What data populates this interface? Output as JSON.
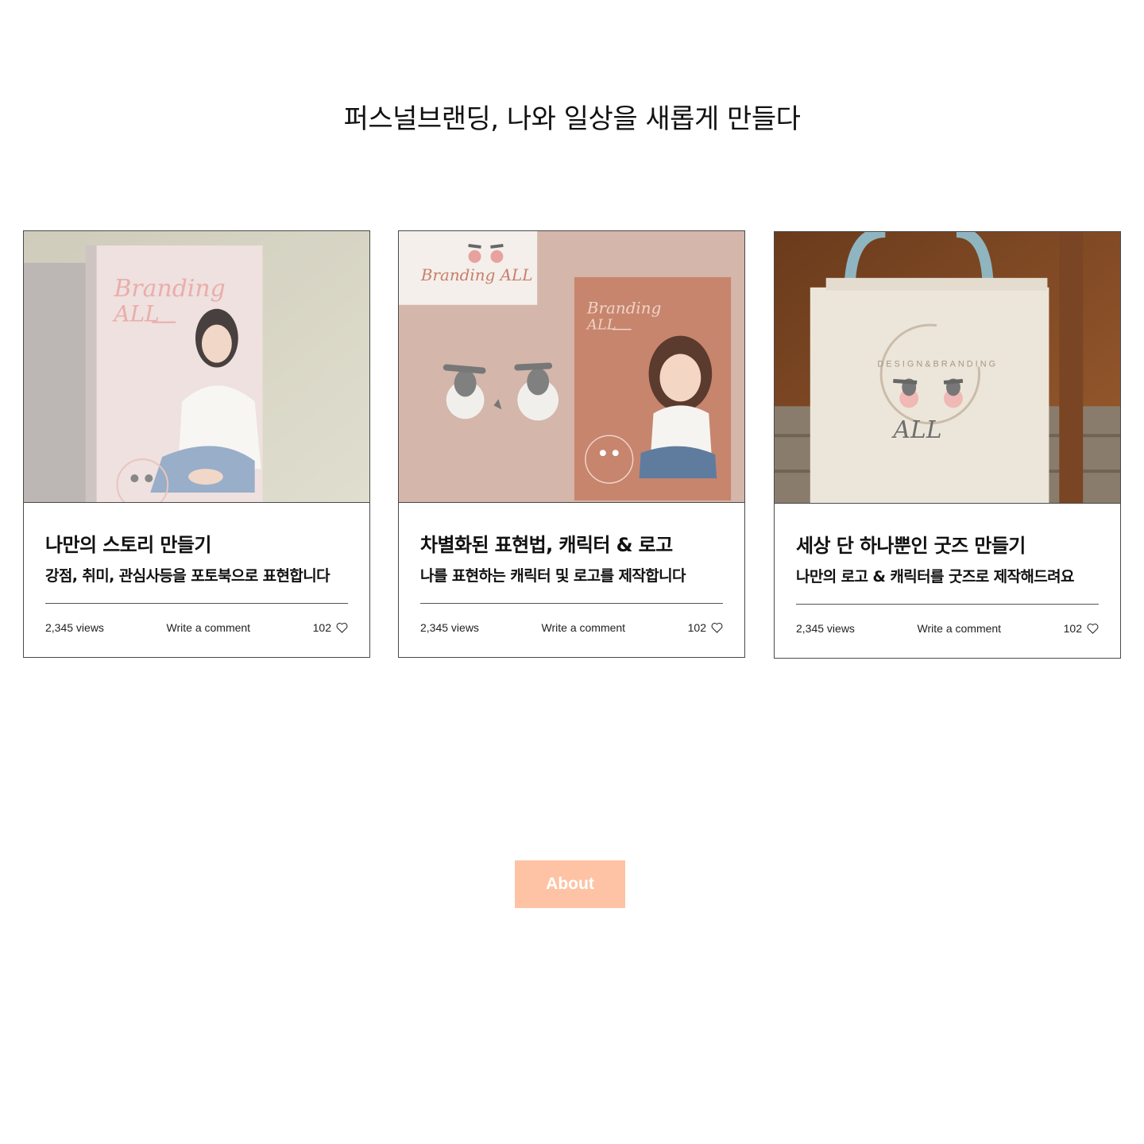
{
  "page": {
    "title": "퍼스널브랜딩, 나와 일상을 새롭게 만들다"
  },
  "cards": [
    {
      "title": "나만의 스토리 만들기",
      "subtitle": "강점, 취미, 관심사등을 포토북으로 표현합니다",
      "views": "2,345 views",
      "comment_label": "Write a comment",
      "likes": "102",
      "image": {
        "description_icon": "photobook-image",
        "cover_text": "Branding ALL___"
      }
    },
    {
      "title": "차별화된 표현법, 캐릭터 & 로고",
      "subtitle": "나를 표현하는 캐릭터 및 로고를 제작합니다",
      "views": "2,345 views",
      "comment_label": "Write a comment",
      "likes": "102",
      "image": {
        "description_icon": "character-logo-image",
        "card_text": "Branding ALL",
        "cover_text": "Branding ALL___"
      }
    },
    {
      "title": "세상 단 하나뿐인 굿즈 만들기",
      "subtitle": "나만의 로고 & 캐릭터를 굿즈로 제작해드려요",
      "views": "2,345 views",
      "comment_label": "Write a comment",
      "likes": "102",
      "image": {
        "description_icon": "tote-bag-image",
        "logo_text": "ALL",
        "ring_text": "DESIGN&BRANDING"
      }
    }
  ],
  "about_button": {
    "label": "About"
  },
  "colors": {
    "accent": "#fdc3a4",
    "border": "#4a4a4a",
    "brand_pink": "#e7a2a0"
  }
}
